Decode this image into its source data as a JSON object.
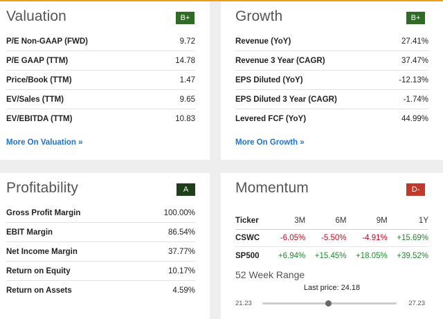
{
  "colors": {
    "grade_green": "#2f6b24",
    "grade_dark": "#1f3f1a",
    "grade_red": "#c0392b",
    "link": "#1a73d9",
    "negative": "#d0021b",
    "positive": "#1a8a2a"
  },
  "valuation": {
    "title": "Valuation",
    "grade": "B+",
    "rows": [
      {
        "label": "P/E Non-GAAP (FWD)",
        "value": "9.72"
      },
      {
        "label": "P/E GAAP (TTM)",
        "value": "14.78"
      },
      {
        "label": "Price/Book (TTM)",
        "value": "1.47"
      },
      {
        "label": "EV/Sales (TTM)",
        "value": "9.65"
      },
      {
        "label": "EV/EBITDA (TTM)",
        "value": "10.83"
      }
    ],
    "more_link": "More On Valuation »"
  },
  "growth": {
    "title": "Growth",
    "grade": "B+",
    "rows": [
      {
        "label": "Revenue (YoY)",
        "value": "27.41%"
      },
      {
        "label": "Revenue 3 Year (CAGR)",
        "value": "37.47%"
      },
      {
        "label": "EPS Diluted (YoY)",
        "value": "-12.13%"
      },
      {
        "label": "EPS Diluted 3 Year (CAGR)",
        "value": "-1.74%"
      },
      {
        "label": "Levered FCF (YoY)",
        "value": "44.99%"
      }
    ],
    "more_link": "More On Growth »"
  },
  "profitability": {
    "title": "Profitability",
    "grade": "A",
    "rows": [
      {
        "label": "Gross Profit Margin",
        "value": "100.00%"
      },
      {
        "label": "EBIT Margin",
        "value": "86.54%"
      },
      {
        "label": "Net Income Margin",
        "value": "37.77%"
      },
      {
        "label": "Return on Equity",
        "value": "10.17%"
      },
      {
        "label": "Return on Assets",
        "value": "4.59%"
      }
    ]
  },
  "momentum": {
    "title": "Momentum",
    "grade": "D-",
    "headers": [
      "Ticker",
      "3M",
      "6M",
      "9M",
      "1Y"
    ],
    "rows": [
      {
        "ticker": "CSWC",
        "values": [
          "-6.05%",
          "-5.50%",
          "-4.91%",
          "+15.69%"
        ]
      },
      {
        "ticker": "SP500",
        "values": [
          "+6.94%",
          "+15.45%",
          "+18.05%",
          "+39.52%"
        ]
      }
    ],
    "range_title": "52 Week Range",
    "last_price": "Last price: 24.18",
    "range_low": "21.23",
    "range_high": "27.23",
    "last_price_value": 24.18,
    "low_value": 21.23,
    "high_value": 27.23
  }
}
